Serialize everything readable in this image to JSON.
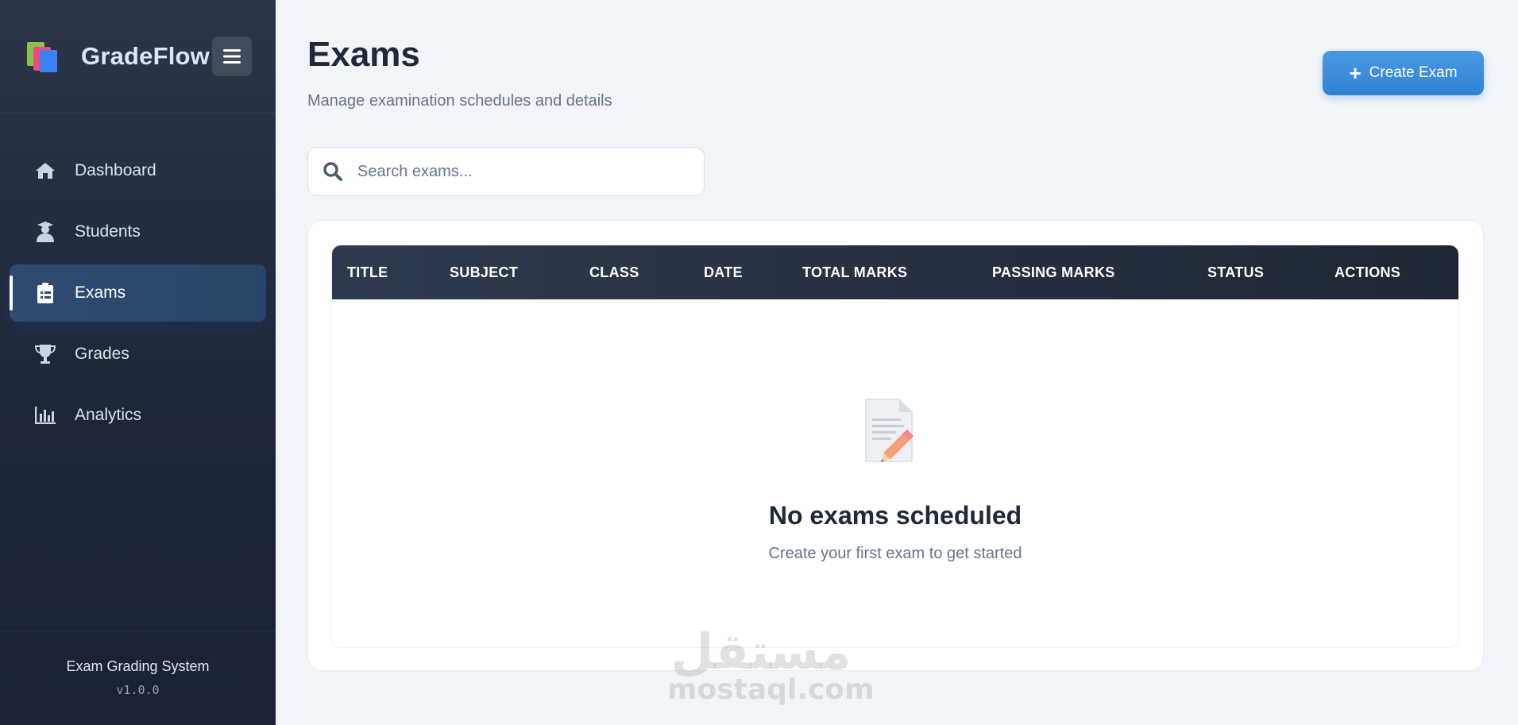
{
  "sidebar": {
    "brand": "GradeFlow",
    "items": [
      {
        "label": "Dashboard",
        "icon": "home-icon"
      },
      {
        "label": "Students",
        "icon": "graduate-icon"
      },
      {
        "label": "Exams",
        "icon": "clipboard-icon",
        "active": true
      },
      {
        "label": "Grades",
        "icon": "trophy-icon"
      },
      {
        "label": "Analytics",
        "icon": "bar-chart-icon"
      }
    ],
    "footer": {
      "title": "Exam Grading System",
      "version": "v1.0.0"
    }
  },
  "header": {
    "title": "Exams",
    "subtitle": "Manage examination schedules and details",
    "create_label": "Create Exam"
  },
  "search": {
    "placeholder": "Search exams..."
  },
  "table": {
    "columns": [
      "TITLE",
      "SUBJECT",
      "CLASS",
      "DATE",
      "TOTAL MARKS",
      "PASSING MARKS",
      "STATUS",
      "ACTIONS"
    ],
    "rows": []
  },
  "empty_state": {
    "title": "No exams scheduled",
    "subtitle": "Create your first exam to get started",
    "icon": "memo-icon"
  },
  "watermark": {
    "arabic": "مستقل",
    "latin": "mostaql.com"
  },
  "colors": {
    "accent": "#3b8ad9",
    "sidebar": "#1e2738",
    "active_nav": "#2f4b72"
  }
}
